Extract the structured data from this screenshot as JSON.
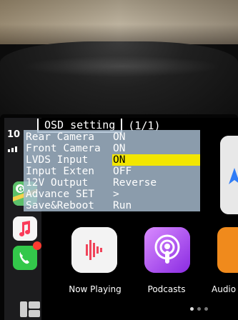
{
  "osd": {
    "title": "OSD setting",
    "page": "(1/1)",
    "items": [
      {
        "label": "Rear Camera",
        "value": "ON"
      },
      {
        "label": "Front Camera",
        "value": "ON"
      },
      {
        "label": "LVDS Input",
        "value": "ON",
        "selected": true
      },
      {
        "label": "Input Exten",
        "value": "OFF"
      },
      {
        "label": "12V Output",
        "value": "Reverse"
      },
      {
        "label": "Advance SET",
        "value": ">"
      },
      {
        "label": "Save&Reboot",
        "value": "Run"
      }
    ],
    "highlight_color": "#f2e600"
  },
  "status": {
    "time": "10"
  },
  "home": {
    "apps": [
      {
        "label": "Now Playing",
        "icon": "now-playing-icon"
      },
      {
        "label": "Podcasts",
        "icon": "podcasts-icon"
      },
      {
        "label": "Audio",
        "icon": "audiobooks-icon"
      }
    ]
  }
}
